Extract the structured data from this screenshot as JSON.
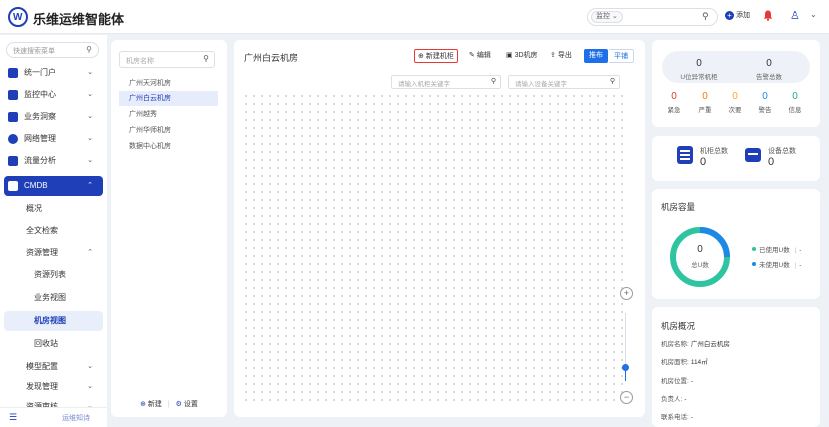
{
  "app": {
    "title": "乐维运维智能体",
    "logo_letter": "W"
  },
  "topbar": {
    "search_prefix": "监控",
    "search_prefix_chevron": "⌄",
    "add_label": "添加",
    "icons": [
      "logo-icon",
      "search-icon",
      "add-icon",
      "bell-icon",
      "user-icon",
      "chevron-down-icon"
    ]
  },
  "sidebar": {
    "search_placeholder": "快速搜索菜单",
    "menu": [
      {
        "label": "统一门户",
        "chevron": "⌄"
      },
      {
        "label": "监控中心",
        "chevron": "⌄"
      },
      {
        "label": "业务洞察",
        "chevron": "⌄"
      },
      {
        "label": "网络管理",
        "chevron": "⌄"
      },
      {
        "label": "流量分析",
        "chevron": "⌄"
      },
      {
        "label": "CMDB",
        "chevron": "⌃"
      }
    ],
    "cmdb_sub": [
      {
        "label": "概况"
      },
      {
        "label": "全文检索"
      },
      {
        "label": "资源管理",
        "chevron": "⌃"
      },
      {
        "label": "资源列表"
      },
      {
        "label": "业务视图"
      },
      {
        "label": "机房视图"
      },
      {
        "label": "回收站"
      },
      {
        "label": "模型配置",
        "chevron": "⌄"
      },
      {
        "label": "发现管理",
        "chevron": "⌄"
      },
      {
        "label": "资源审核",
        "chevron": "⌄"
      }
    ],
    "bottom_brand": "运维知诗"
  },
  "room_panel": {
    "search_placeholder": "机房名称",
    "rooms": [
      "广州天河机房",
      "广州白云机房",
      "广州越秀",
      "广州华师机房",
      "数据中心机房"
    ],
    "selected_index": 1,
    "footer_new": "新建",
    "footer_settings": "设置"
  },
  "main": {
    "title": "广州白云机房",
    "toolbar": {
      "new_cabinet": "新建机柜",
      "edit": "编辑",
      "room_3d": "3D机房",
      "export": "导出",
      "layout_on": "推布",
      "layout_off": "平铺"
    },
    "cabinet_search_placeholder": "请输入机柜关键字",
    "device_search_placeholder": "请输入设备关键字",
    "zoom_in": "+",
    "zoom_out": "−",
    "zoom_level_fraction": 0.2
  },
  "right": {
    "u_stats": [
      {
        "value": "0",
        "label": "U位异常机柜"
      },
      {
        "value": "0",
        "label": "告警总数"
      }
    ],
    "severity": [
      {
        "value": "0",
        "label": "紧急",
        "color": "#e53935"
      },
      {
        "value": "0",
        "label": "严重",
        "color": "#f57c00"
      },
      {
        "value": "0",
        "label": "次要",
        "color": "#f9a825"
      },
      {
        "value": "0",
        "label": "警告",
        "color": "#1e88e5"
      },
      {
        "value": "0",
        "label": "信息",
        "color": "#26a69a"
      }
    ],
    "totals": [
      {
        "label": "机柜总数",
        "value": "0"
      },
      {
        "label": "设备总数",
        "value": "0"
      }
    ],
    "capacity": {
      "title": "机房容量",
      "center_value": "0",
      "center_label": "总U数",
      "legend": [
        {
          "label": "已使用U数",
          "value": "-",
          "color": "#2ec4a0"
        },
        {
          "label": "未使用U数",
          "value": "-",
          "color": "#1e88e5"
        }
      ]
    },
    "overview": {
      "title": "机房概况",
      "rows": [
        {
          "label": "机房名称:",
          "value": "广州白云机房"
        },
        {
          "label": "机房面积:",
          "value": "114㎡"
        },
        {
          "label": "机房位置:",
          "value": "-"
        },
        {
          "label": "负责人:",
          "value": "-"
        },
        {
          "label": "联系电话:",
          "value": "-"
        }
      ]
    }
  },
  "colors": {
    "accent": "#1f3fb8",
    "highlight_border": "#e53935",
    "segment_blue": "#1f6fe8"
  }
}
